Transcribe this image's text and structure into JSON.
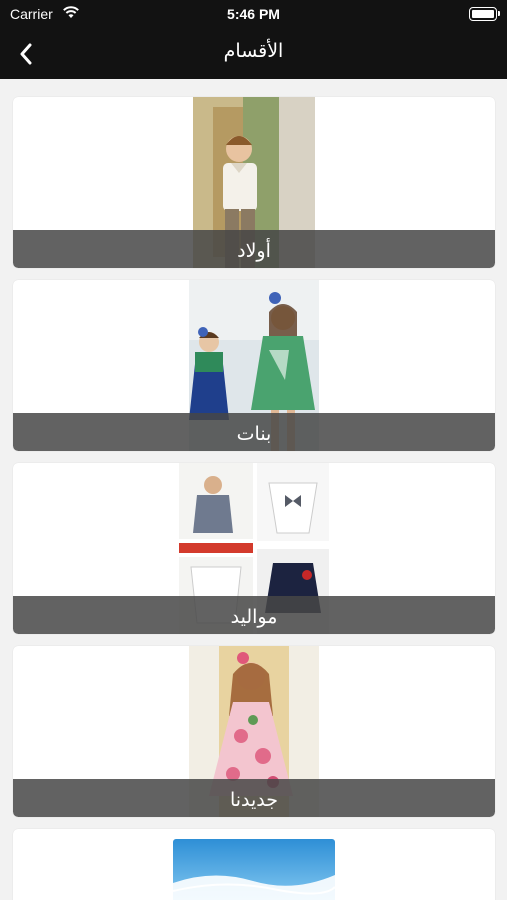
{
  "status_bar": {
    "carrier": "Carrier",
    "time": "5:46 PM"
  },
  "nav": {
    "title": "الأقسام",
    "back_icon": "chevron-left-icon"
  },
  "categories": [
    {
      "label": "أولاد"
    },
    {
      "label": "بنات"
    },
    {
      "label": "مواليد"
    },
    {
      "label": "جديدنا"
    }
  ],
  "colors": {
    "bar_background": "#121212",
    "page_background": "#f2f2f2",
    "label_overlay": "#464646"
  }
}
